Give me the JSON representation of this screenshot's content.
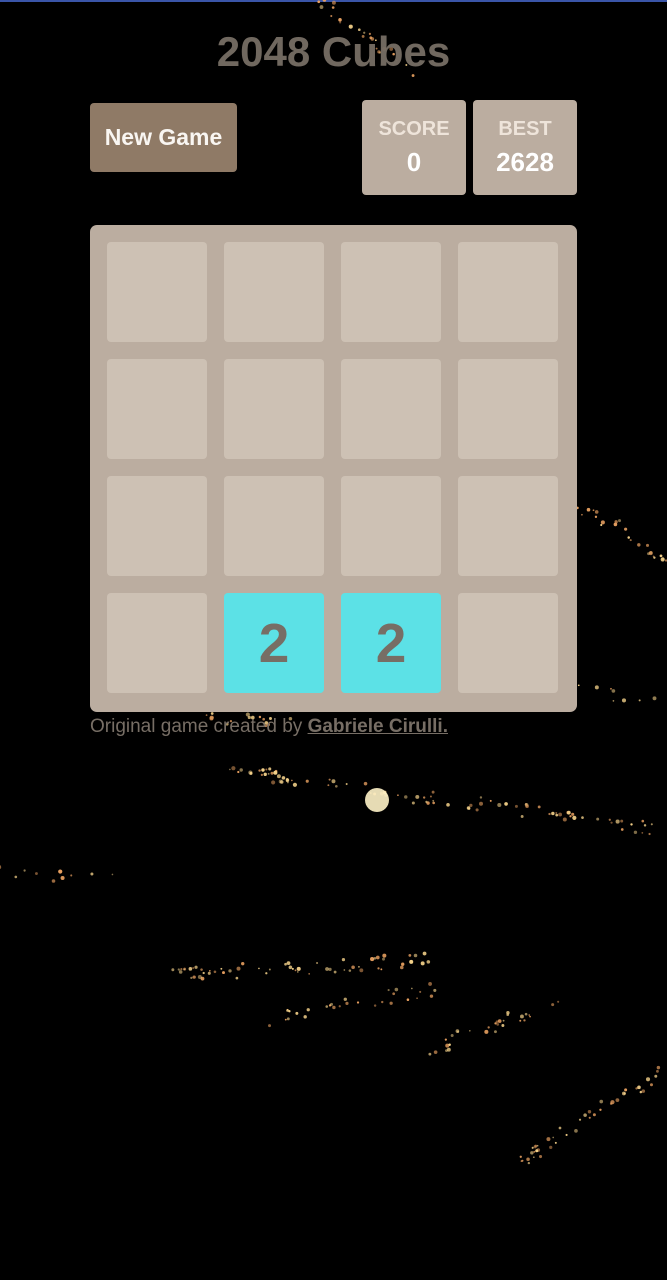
{
  "title": "2048 Cubes",
  "new_game_label": "New Game",
  "score": {
    "label": "SCORE",
    "value": "0"
  },
  "best": {
    "label": "BEST",
    "value": "2628"
  },
  "board": {
    "size": 4,
    "rows": [
      [
        "",
        "",
        "",
        ""
      ],
      [
        "",
        "",
        "",
        ""
      ],
      [
        "",
        "",
        "",
        ""
      ],
      [
        "",
        "2",
        "2",
        ""
      ]
    ]
  },
  "footer": {
    "text": "Original game created by ",
    "link_text": "Gabriele Cirulli."
  },
  "colors": {
    "background": "#000000",
    "board": "#bbada0",
    "empty_cell": "#cdc1b4",
    "tile_2": "#5ce1e6",
    "text_dark": "#776e65",
    "button": "#8f7a66"
  }
}
